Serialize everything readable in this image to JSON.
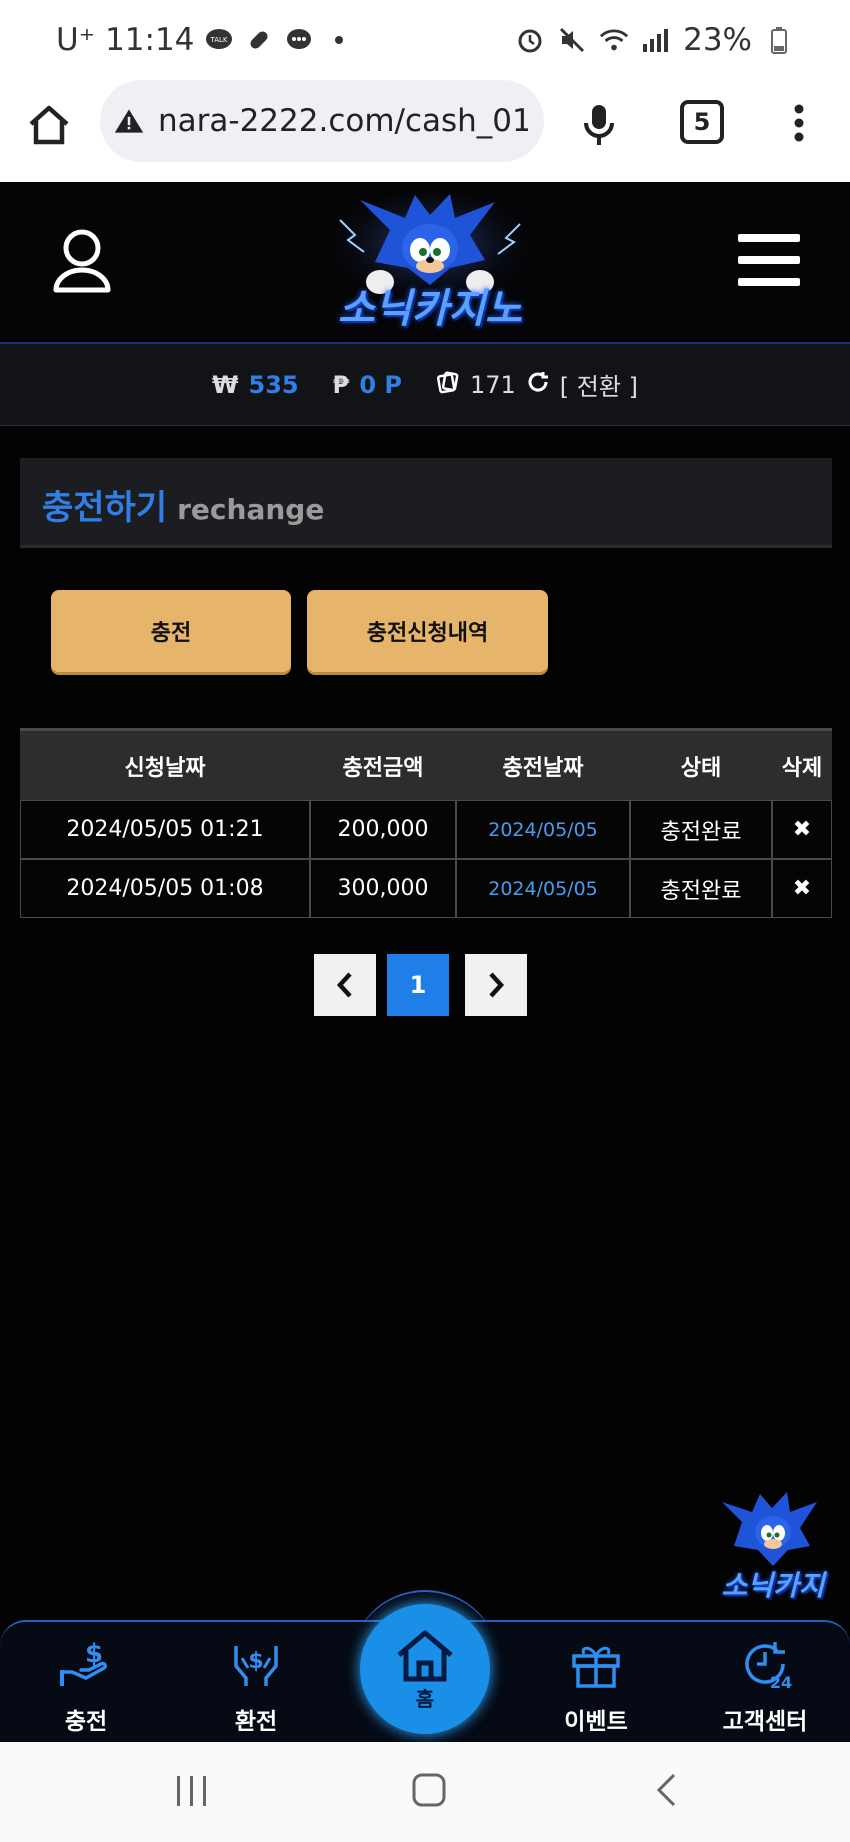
{
  "status_bar": {
    "carrier": "U⁺",
    "time": "11:14",
    "battery": "23%"
  },
  "browser": {
    "url": "nara-2222.com/cash_01.",
    "tab_count": "5"
  },
  "header": {
    "logo_text": "소닉카지노"
  },
  "balance": {
    "won_symbol": "₩",
    "won_value": "535",
    "point_symbol": "₱",
    "point_value": "0 P",
    "chip_value": "171",
    "convert_label": "[ 전환 ]"
  },
  "section": {
    "title_ko": "충전하기",
    "title_en": "rechange"
  },
  "buttons": {
    "charge": "충전",
    "history": "충전신청내역"
  },
  "table": {
    "headers": [
      "신청날짜",
      "충전금액",
      "충전날짜",
      "상태",
      "삭제"
    ],
    "rows": [
      {
        "request_date": "2024/05/05 01:21",
        "amount": "200,000",
        "charge_date": "2024/05/05",
        "status": "충전완료",
        "delete": "✖"
      },
      {
        "request_date": "2024/05/05 01:08",
        "amount": "300,000",
        "charge_date": "2024/05/05",
        "status": "충전완료",
        "delete": "✖"
      }
    ]
  },
  "pagination": {
    "prev": "‹",
    "current": "1",
    "next": "›"
  },
  "bottom_nav": {
    "charge": "충전",
    "exchange": "환전",
    "home": "홈",
    "event": "이벤트",
    "support": "고객센터"
  },
  "float_logo_text": "소닉카지",
  "colors": {
    "accent_blue": "#2f7fe6",
    "button_gold": "#e6b56b",
    "home_blue": "#1a8fe8"
  }
}
